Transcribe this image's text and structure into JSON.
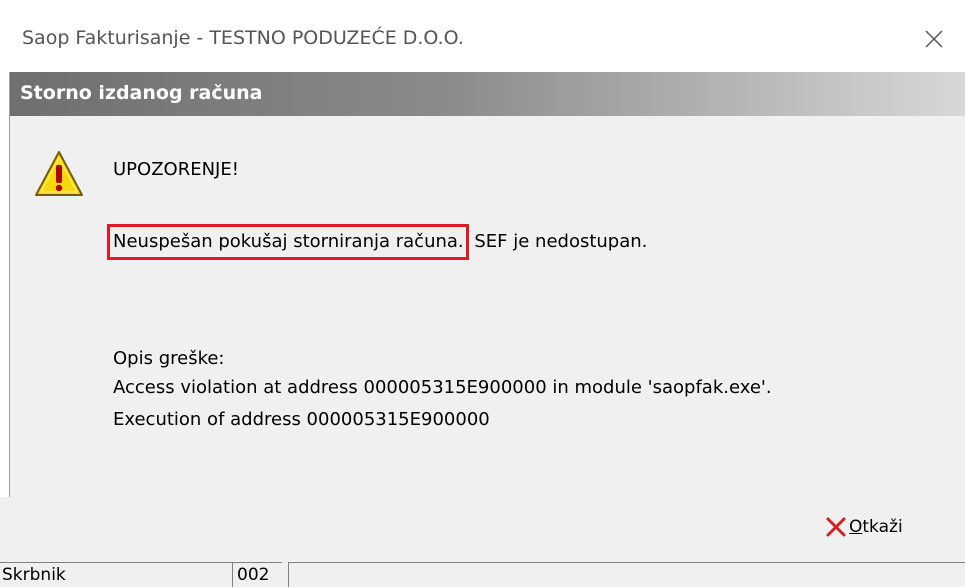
{
  "window": {
    "title": "Saop Fakturisanje - TESTNO PODUZEĆE D.O.O."
  },
  "dialog": {
    "title": "Storno izdanog računa",
    "heading": "UPOZORENJE!",
    "highlighted_text": "Neuspešan pokušaj storniranja računa.",
    "message_rest": " SEF je nedostupan.",
    "error_label": "Opis greške:",
    "error_line1": "Access violation at address 000005315E900000 in module 'saopfak.exe'.",
    "error_line2": "Execution of address 000005315E900000"
  },
  "footer": {
    "cancel_label_first": "O",
    "cancel_label_rest": "tkaži"
  },
  "statusbar": {
    "user": "Skrbnik",
    "code": "002",
    "info": ""
  },
  "colors": {
    "highlight_border": "#e01a25",
    "header_gradient_start": "#6f6f6f",
    "header_gradient_end": "#d8d8d8",
    "dialog_bg": "#f0f0f0",
    "warning_fill": "#f5d90a",
    "cancel_icon": "#d22222"
  },
  "icons": {
    "warning": "warning-triangle-icon",
    "close": "close-icon",
    "cancel": "red-x-icon"
  }
}
